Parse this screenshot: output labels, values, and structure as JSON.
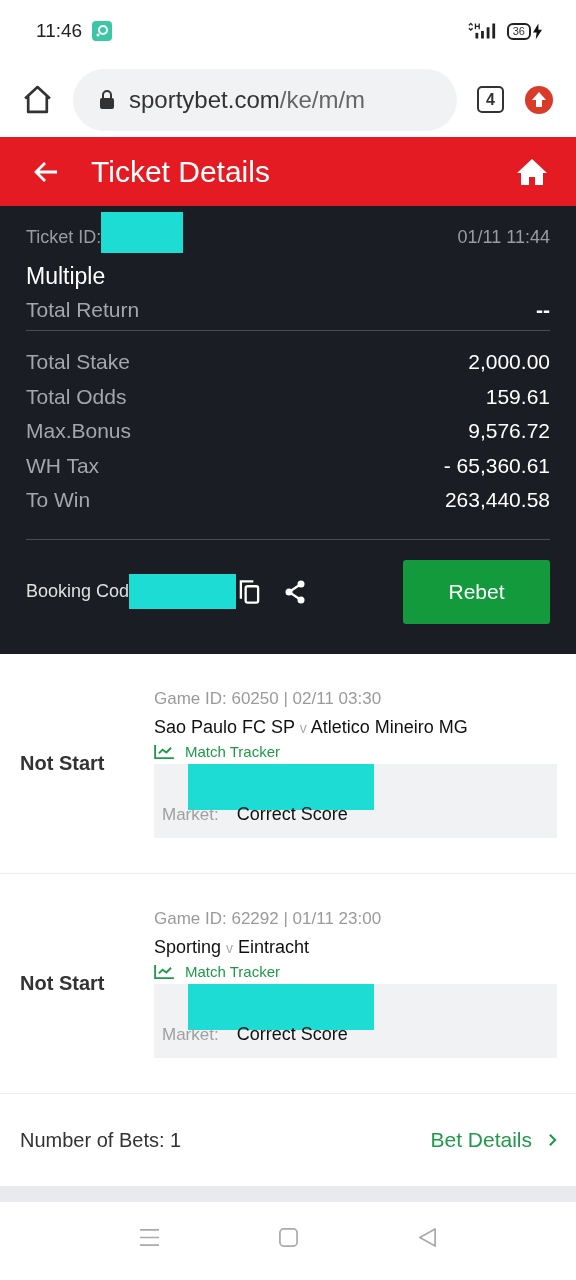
{
  "status_bar": {
    "time": "11:46",
    "battery": "36"
  },
  "browser": {
    "url_host": "sportybet.com",
    "url_path": "/ke/m/m",
    "tab_count": "4"
  },
  "header": {
    "title": "Ticket Details"
  },
  "ticket": {
    "id_label": "Ticket ID:",
    "date": "01/11 11:44",
    "type": "Multiple",
    "return_label": "Total Return",
    "return_value": "--",
    "figures": [
      {
        "label": "Total Stake",
        "value": "2,000.00"
      },
      {
        "label": "Total Odds",
        "value": "159.61"
      },
      {
        "label": "Max.Bonus",
        "value": "9,576.72"
      },
      {
        "label": "WH Tax",
        "value": "- 65,360.61"
      },
      {
        "label": "To Win",
        "value": "263,440.58"
      }
    ],
    "booking_label": "Booking Cod",
    "rebet": "Rebet"
  },
  "bets": [
    {
      "status": "Not Start",
      "game": "Game ID: 60250 | 02/11 03:30",
      "home": "Sao Paulo FC SP",
      "sep": "v",
      "away": "Atletico Mineiro MG",
      "tracker": "Match Tracker",
      "market_label": "Market:",
      "market": "Correct Score"
    },
    {
      "status": "Not Start",
      "game": "Game ID: 62292 | 01/11 23:00",
      "home": "Sporting",
      "sep": "v",
      "away": "Eintracht",
      "tracker": "Match Tracker",
      "market_label": "Market:",
      "market": "Correct Score"
    }
  ],
  "footer": {
    "count": "Number of Bets: 1",
    "link": "Bet Details"
  }
}
